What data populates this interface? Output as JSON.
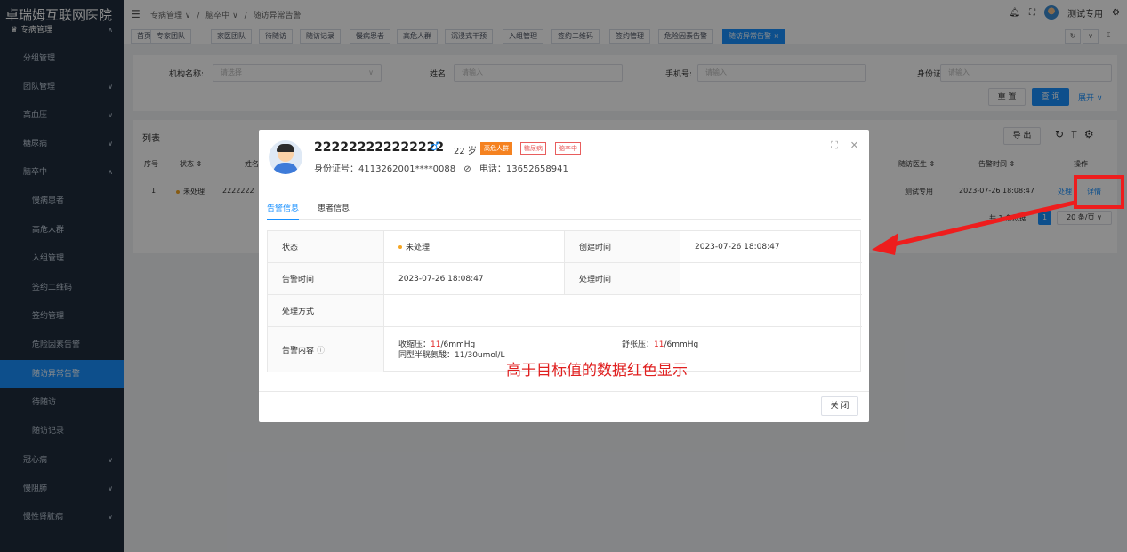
{
  "app": {
    "title": "卓瑞姆互联网医院"
  },
  "sidebar": {
    "top_section": "专病管理",
    "items": [
      {
        "label": "分组管理"
      },
      {
        "label": "团队管理"
      },
      {
        "label": "高血压"
      },
      {
        "label": "糖尿病"
      },
      {
        "label": "脑卒中"
      }
    ],
    "sub_items": [
      {
        "label": "慢病患者"
      },
      {
        "label": "高危人群"
      },
      {
        "label": "入组管理"
      },
      {
        "label": "签约二维码"
      },
      {
        "label": "签约管理"
      },
      {
        "label": "危险因素告警"
      },
      {
        "label": "随访异常告警"
      },
      {
        "label": "待随访"
      },
      {
        "label": "随访记录"
      }
    ],
    "bottom_items": [
      {
        "label": "冠心病"
      },
      {
        "label": "慢阻肺"
      },
      {
        "label": "慢性肾脏病"
      }
    ]
  },
  "header": {
    "breadcrumb": [
      "专病管理 ∨",
      "/",
      "脑卒中 ∨",
      "/",
      "随访异常告警"
    ],
    "user_name": "测试专用"
  },
  "tags": [
    "首页",
    "专家团队",
    "家医团队",
    "待随访",
    "随访记录",
    "慢病患者",
    "高危人群",
    "沉浸式干预",
    "入组管理",
    "签约二维码",
    "签约管理",
    "危险因素告警",
    "随访异常告警 ×"
  ],
  "search": {
    "org_label": "机构名称:",
    "org_placeholder": "请选择",
    "name_label": "姓名:",
    "name_placeholder": "请输入",
    "phone_label": "手机号:",
    "phone_placeholder": "请输入",
    "id_label": "身份证:",
    "id_placeholder": "请输入",
    "reset": "重 置",
    "query": "查 询",
    "expand": "展开 ∨"
  },
  "list": {
    "title": "列表",
    "export": "导 出",
    "columns": [
      "序号",
      "状态 ⇕",
      "姓名",
      "随访医生 ⇕",
      "告警时间 ⇕",
      "操作"
    ],
    "row": {
      "index": "1",
      "status": "未处理",
      "name": "2222222",
      "doctor": "测试专用",
      "alarm_time": "2023-07-26 18:08:47",
      "action1": "处理",
      "action2": "详情"
    },
    "pagination": {
      "total": "共 1 条数据",
      "page": "1",
      "size": "20 条/页 ∨"
    }
  },
  "modal": {
    "name": "222222222222222",
    "gender_symbol": "♂",
    "age": "22 岁",
    "badges": [
      "高危人群",
      "糖尿病",
      "脑卒中"
    ],
    "id_line": "身份证号：4113262001****0088",
    "phone": "电话：13652658941",
    "tabs": [
      "告警信息",
      "患者信息"
    ],
    "fields": {
      "status_label": "状态",
      "status_value": "未处理",
      "created_label": "创建时间",
      "created_value": "2023-07-26 18:08:47",
      "alarm_label": "告警时间",
      "alarm_value": "2023-07-26 18:08:47",
      "handled_label": "处理时间",
      "handled_value": "",
      "method_label": "处理方式",
      "method_value": "",
      "content_label": "告警内容",
      "systolic_prefix": "收缩压：",
      "systolic_value": "11",
      "systolic_suffix": "/6mmHg",
      "diastolic_prefix": "舒张压：",
      "diastolic_value": "11",
      "diastolic_suffix": "/6mmHg",
      "homocysteine": "同型半胱氨酸：11/30umol/L"
    },
    "close_label": "关 闭"
  },
  "annotation": {
    "text": "高于目标值的数据红色显示",
    "color": "#e02020"
  },
  "colors": {
    "primary": "#1890ff",
    "sidebar": "#1f2d3d",
    "highlight": "#ee1d1d"
  }
}
